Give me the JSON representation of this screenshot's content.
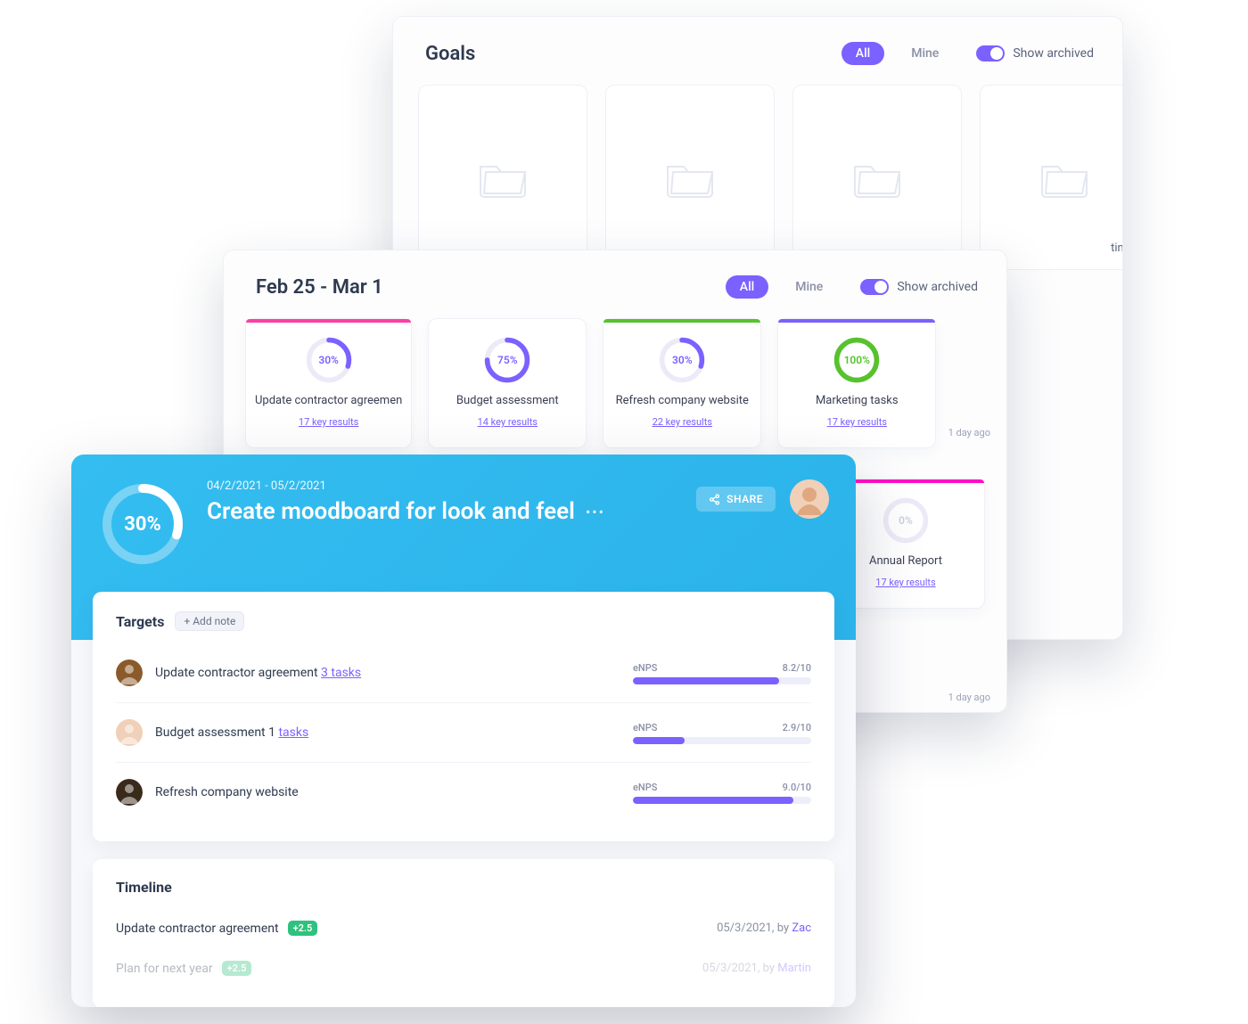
{
  "colors": {
    "accent": "#7b61ff",
    "pink": "#ff3ea5",
    "green": "#57c22d",
    "sky": "#34bdf0"
  },
  "panel1": {
    "title": "Goals",
    "filters": {
      "all": "All",
      "mine": "Mine"
    },
    "archived": "Show archived",
    "cards": [
      {
        "label": ""
      },
      {
        "label": ""
      },
      {
        "label": ""
      },
      {
        "label": ""
      }
    ],
    "visible_caption": "ting"
  },
  "panel2": {
    "title": "Feb 25 - Mar 1",
    "filters": {
      "all": "All",
      "mine": "Mine"
    },
    "archived": "Show archived",
    "cards": [
      {
        "title": "Update contractor agreemen",
        "sub": "17 key results",
        "pct": 30,
        "pct_label": "30%",
        "bar": "#ff3ea5",
        "ring": "#7b61ff"
      },
      {
        "title": "Budget assessment",
        "sub": "14 key results",
        "pct": 75,
        "pct_label": "75%",
        "bar": null,
        "ring": "#7b61ff"
      },
      {
        "title": "Refresh company website",
        "sub": "22 key results",
        "pct": 30,
        "pct_label": "30%",
        "bar": "#57c22d",
        "ring": "#7b61ff"
      },
      {
        "title": "Marketing tasks",
        "sub": "17 key results",
        "pct": 100,
        "pct_label": "100%",
        "bar": "#7b61ff",
        "ring": "#57c22d"
      }
    ],
    "extra_card": {
      "title": "Annual Report",
      "sub": "17 key results",
      "pct": 0,
      "pct_label": "0%",
      "bar": "#ff0fc6",
      "ring": "#c9cee2"
    },
    "footer": "1 day ago"
  },
  "detail": {
    "pct_label": "30%",
    "pct": 30,
    "dates": "04/2/2021 - 05/2/2021",
    "title": "Create moodboard for look and feel",
    "share": "SHARE",
    "targets_heading": "Targets",
    "add_note": "+ Add note",
    "metric_label": "eNPS",
    "targets": [
      {
        "label": "Update contractor agreement",
        "tasks_text": "3 tasks",
        "score": "8.2/10",
        "frac": 0.82
      },
      {
        "label": "Budget assessment 1",
        "tasks_text": "tasks",
        "score": "2.9/10",
        "frac": 0.29
      },
      {
        "label": "Refresh company website",
        "tasks_text": "",
        "score": "9.0/10",
        "frac": 0.9
      }
    ],
    "timeline_heading": "Timeline",
    "timeline": [
      {
        "label": "Update contractor agreement",
        "delta": "+2.5",
        "date": "05/3/2021",
        "by": "by",
        "author": "Zac",
        "faded": false
      },
      {
        "label": "Plan for next year",
        "delta": "+2.5",
        "date": "05/3/2021",
        "by": "by",
        "author": "Martin",
        "faded": true
      }
    ]
  }
}
